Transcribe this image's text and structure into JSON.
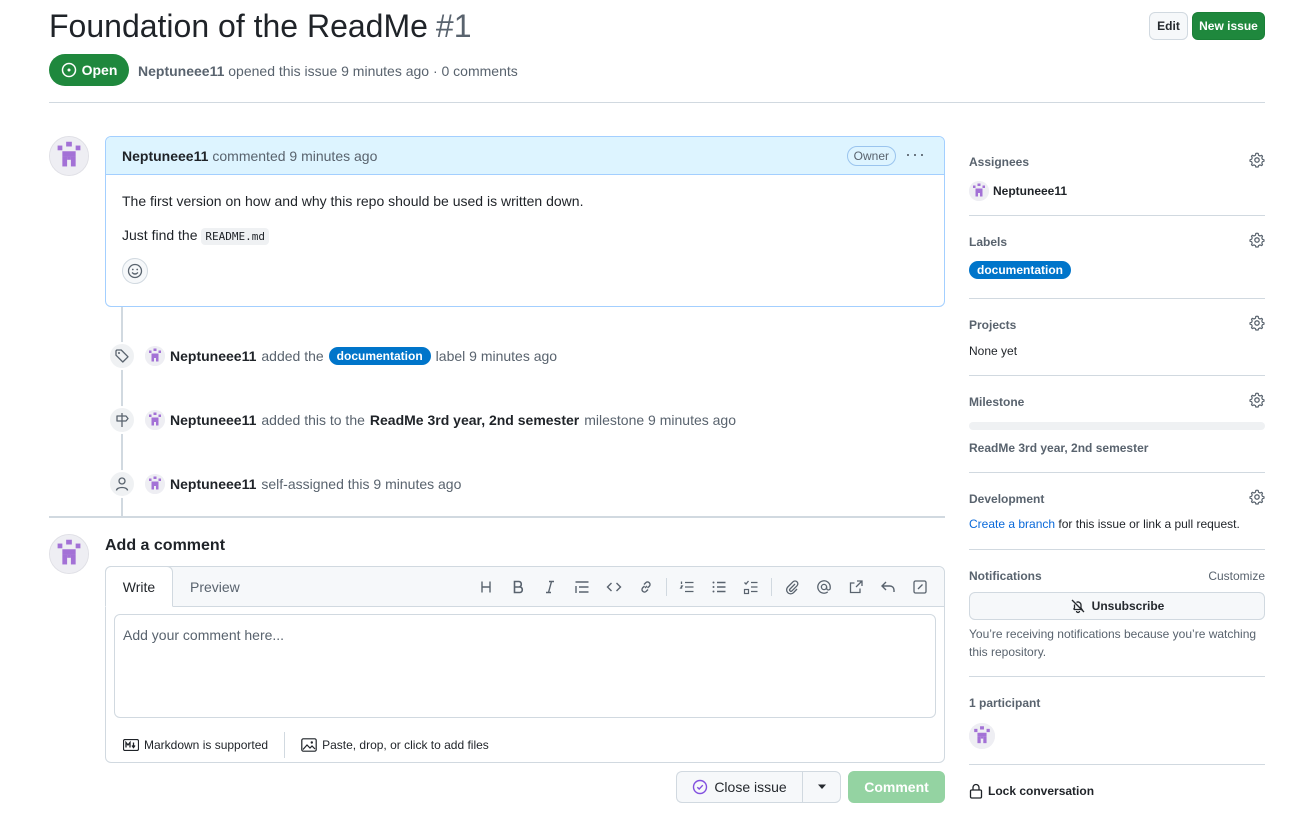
{
  "issue": {
    "title": "Foundation of the ReadMe",
    "number": "#1",
    "state": "Open",
    "author": "Neptuneee11",
    "meta_text": "opened this issue 9 minutes ago · 0 comments"
  },
  "header_buttons": {
    "edit": "Edit",
    "new_issue": "New issue"
  },
  "comment": {
    "author": "Neptuneee11",
    "time": "commented 9 minutes ago",
    "badge": "Owner",
    "paragraph1": "The first version on how and why this repo should be used is written down.",
    "paragraph2_prefix": "Just find the",
    "code": "README.md"
  },
  "timeline": [
    {
      "icon": "tag-icon",
      "author": "Neptuneee11",
      "pre": "added the",
      "label": "documentation",
      "post": "label 9 minutes ago"
    },
    {
      "icon": "milestone-icon",
      "author": "Neptuneee11",
      "pre": "added this to the",
      "strong": "ReadMe 3rd year, 2nd semester",
      "post": "milestone 9 minutes ago"
    },
    {
      "icon": "person-icon",
      "author": "Neptuneee11",
      "pre": "self-assigned this 9 minutes ago"
    }
  ],
  "add_comment": {
    "title": "Add a comment",
    "tab_write": "Write",
    "tab_preview": "Preview",
    "placeholder": "Add your comment here...",
    "markdown_note": "Markdown is supported",
    "files_note": "Paste, drop, or click to add files",
    "close_issue": "Close issue",
    "comment_button": "Comment"
  },
  "sidebar": {
    "assignees": {
      "heading": "Assignees",
      "user": "Neptuneee11"
    },
    "labels": {
      "heading": "Labels",
      "label": "documentation",
      "label_color": "#0075ca"
    },
    "projects": {
      "heading": "Projects",
      "value": "None yet"
    },
    "milestone": {
      "heading": "Milestone",
      "value": "ReadMe 3rd year, 2nd semester"
    },
    "development": {
      "heading": "Development",
      "link": "Create a branch",
      "rest": "for this issue or link a pull request."
    },
    "notifications": {
      "heading": "Notifications",
      "customize": "Customize",
      "unsubscribe": "Unsubscribe",
      "note": "You’re receiving notifications because you’re watching this repository."
    },
    "participants": {
      "heading": "1 participant"
    },
    "lock": "Lock conversation"
  },
  "colors": {
    "open_green": "#1f883d",
    "label_blue": "#0075ca",
    "link_blue": "#0969da",
    "comment_disabled": "#94d3a2",
    "avatar_purple": "#a371d6"
  }
}
